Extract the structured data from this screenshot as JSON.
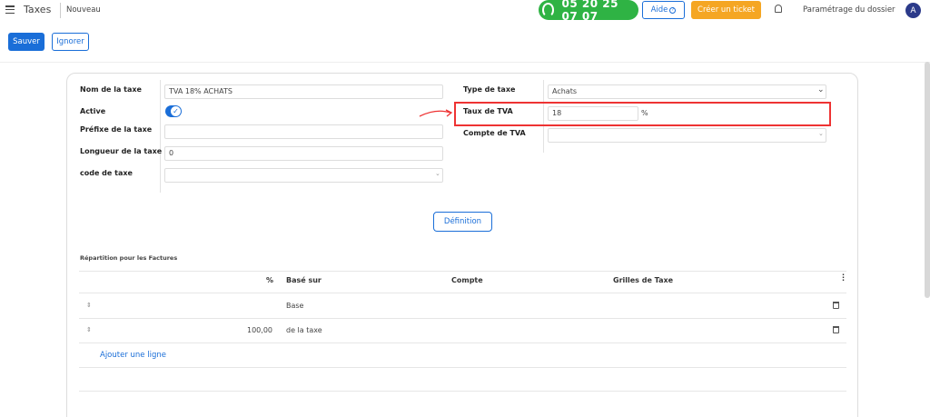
{
  "header": {
    "app_title": "Taxes",
    "breadcrumb": "Nouveau",
    "phone": "05 20 25 07 07",
    "help_label": "Aide",
    "ticket_label": "Créer un ticket",
    "settings_label": "Paramétrage du dossier",
    "avatar_letter": "A"
  },
  "actions": {
    "save": "Sauver",
    "ignore": "Ignorer"
  },
  "form": {
    "name_label": "Nom de la taxe",
    "name_value": "TVA 18% ACHATS",
    "active_label": "Active",
    "prefix_label": "Préfixe de la taxe",
    "prefix_value": "",
    "length_label": "Longueur de la taxe",
    "length_value": "0",
    "code_label": "code de taxe",
    "code_value": "",
    "type_label": "Type de taxe",
    "type_value": "Achats",
    "rate_label": "Taux de TVA",
    "rate_value": "18",
    "rate_unit": "%",
    "account_label": "Compte de TVA",
    "account_value": ""
  },
  "definition_button": "Définition",
  "distribution": {
    "title": "Répartition pour les Factures",
    "columns": [
      "%",
      "Basé sur",
      "Compte",
      "Grilles de Taxe"
    ],
    "rows": [
      {
        "percent": "",
        "based_on": "Base",
        "account": "",
        "grids": ""
      },
      {
        "percent": "100,00",
        "based_on": "de la taxe",
        "account": "",
        "grids": ""
      }
    ],
    "add_line": "Ajouter une ligne"
  },
  "colors": {
    "primary": "#1a6ed8",
    "phone_green": "#2fb344",
    "ticket_orange": "#f5a623",
    "highlight_red": "#e33333"
  }
}
